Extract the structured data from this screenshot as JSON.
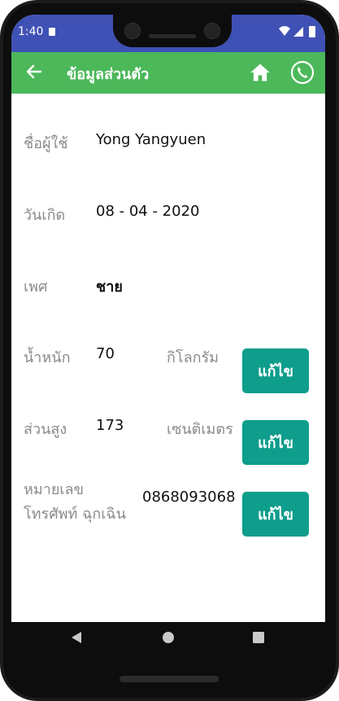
{
  "status_bar": {
    "time": "1:40",
    "bg_color": "#3f51b5"
  },
  "app_bar": {
    "title": "ข้อมูลส่วนตัว",
    "bg_color": "#4cb85a",
    "icons": [
      "arrow-left-icon",
      "home-icon",
      "phone-icon"
    ]
  },
  "profile": {
    "username": {
      "label": "ชื่อผู้ใช้",
      "value": "Yong Yangyuen"
    },
    "birthdate": {
      "label": "วันเกิด",
      "value": "08 - 04 - 2020"
    },
    "gender": {
      "label": "เพศ",
      "value": "ชาย"
    },
    "weight": {
      "label": "น้ำหนัก",
      "value": "70",
      "unit": "กิโลกรัม",
      "button": "แก้ไข"
    },
    "height": {
      "label": "ส่วนสูง",
      "value": "173",
      "unit": "เซนติเมตร",
      "button": "แก้ไข"
    },
    "emergency_phone": {
      "label_line1": "หมายเลข",
      "label_line2": "โทรศัพท์ ฉุกเฉิน",
      "value": "0868093068",
      "button": "แก้ไข"
    }
  },
  "colors": {
    "edit_button": "#0f9d8c",
    "label_text": "#8a8a8a"
  },
  "nav_bar": {
    "icons": [
      "back-triangle-icon",
      "home-circle-icon",
      "recents-square-icon"
    ]
  }
}
